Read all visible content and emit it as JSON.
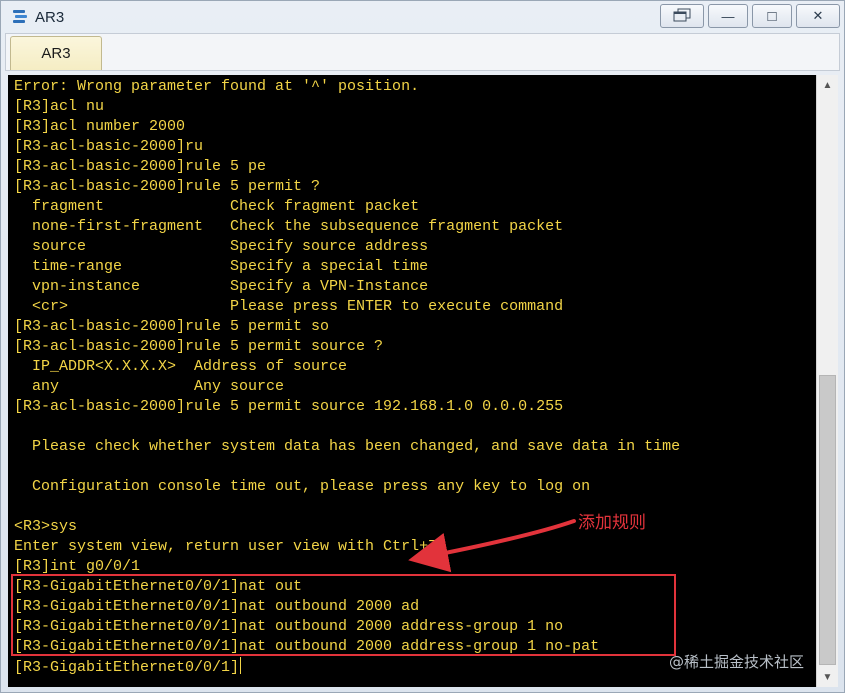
{
  "window": {
    "title": "AR3",
    "icon": "router-app-icon",
    "controls": {
      "restore_icon": "restore-window-icon",
      "minimize_label": "—",
      "maximize_label": "□",
      "close_label": "✕"
    }
  },
  "tabs": [
    {
      "label": "AR3"
    }
  ],
  "terminal": {
    "text_color": "#f3d547",
    "background": "#000000",
    "lines": [
      "Error: Wrong parameter found at '^' position.",
      "[R3]acl nu",
      "[R3]acl number 2000",
      "[R3-acl-basic-2000]ru",
      "[R3-acl-basic-2000]rule 5 pe",
      "[R3-acl-basic-2000]rule 5 permit ?",
      "  fragment              Check fragment packet",
      "  none-first-fragment   Check the subsequence fragment packet",
      "  source                Specify source address",
      "  time-range            Specify a special time",
      "  vpn-instance          Specify a VPN-Instance",
      "  <cr>                  Please press ENTER to execute command",
      "[R3-acl-basic-2000]rule 5 permit so",
      "[R3-acl-basic-2000]rule 5 permit source ?",
      "  IP_ADDR<X.X.X.X>  Address of source",
      "  any               Any source",
      "[R3-acl-basic-2000]rule 5 permit source 192.168.1.0 0.0.0.255",
      "",
      "  Please check whether system data has been changed, and save data in time",
      "",
      "  Configuration console time out, please press any key to log on",
      "",
      "<R3>sys",
      "Enter system view, return user view with Ctrl+Z.",
      "[R3]int g0/0/1",
      "[R3-GigabitEthernet0/0/1]nat out",
      "[R3-GigabitEthernet0/0/1]nat outbound 2000 ad",
      "[R3-GigabitEthernet0/0/1]nat outbound 2000 address-group 1 no",
      "[R3-GigabitEthernet0/0/1]nat outbound 2000 address-group 1 no-pat",
      "[R3-GigabitEthernet0/0/1]"
    ]
  },
  "annotation": {
    "label": "添加规则",
    "color": "#e2333b"
  },
  "watermark": "@稀土掘金技术社区"
}
